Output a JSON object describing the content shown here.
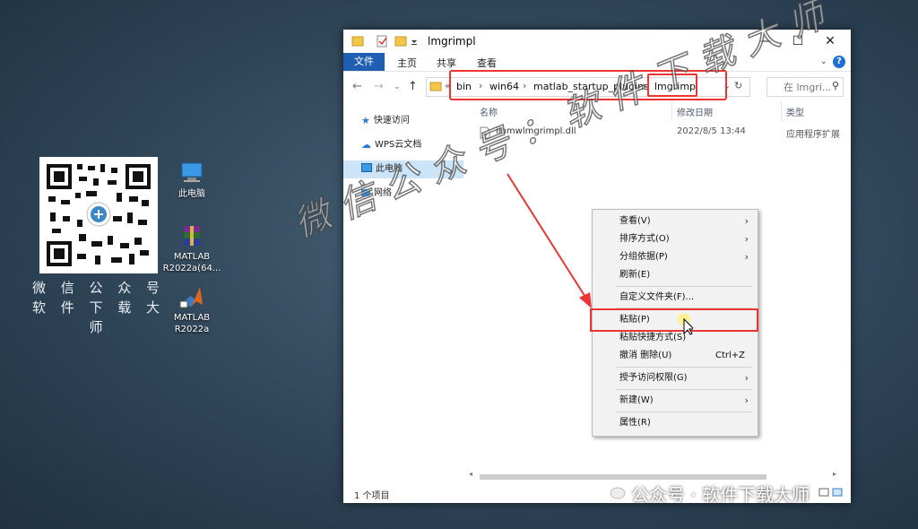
{
  "desktop": {
    "qr_caption_line1": "微 信 公 众 号",
    "qr_caption_line2": "软 件 下 载 大 师",
    "icons": [
      {
        "label": "此电脑"
      },
      {
        "label": "MATLAB R2022a(64..."
      },
      {
        "label": "MATLAB R2022a"
      }
    ]
  },
  "window": {
    "title": "lmgrimpl",
    "controls": {
      "minimize": "—",
      "maximize": "☐",
      "close": "✕"
    },
    "ribbon_tabs": [
      "文件",
      "主页",
      "共享",
      "查看"
    ],
    "help": "?",
    "address": {
      "overflow": "«",
      "crumbs": [
        "bin",
        "win64",
        "matlab_startup_plugins",
        "lmgrimpl"
      ],
      "search_placeholder": "在 lmgri..."
    },
    "nav": [
      "快速访问",
      "WPS云文档",
      "此电脑",
      "网络"
    ],
    "columns": [
      "名称",
      "修改日期",
      "类型"
    ],
    "files": [
      {
        "name": "libmwlmgrimpl.dll",
        "modified": "2022/8/5 13:44",
        "type": "应用程序扩展"
      }
    ],
    "status": "1 个项目"
  },
  "context_menu": {
    "items": [
      {
        "label": "查看(V)",
        "submenu": true
      },
      {
        "label": "排序方式(O)",
        "submenu": true
      },
      {
        "label": "分组依据(P)",
        "submenu": true
      },
      {
        "label": "刷新(E)"
      },
      {
        "label": "自定义文件夹(F)..."
      },
      {
        "label": "粘贴(P)"
      },
      {
        "label": "粘贴快捷方式(S)"
      },
      {
        "label": "撤消 删除(U)",
        "accel": "Ctrl+Z"
      },
      {
        "label": "授予访问权限(G)",
        "submenu": true
      },
      {
        "label": "新建(W)",
        "submenu": true
      },
      {
        "label": "属性(R)"
      }
    ]
  },
  "watermark": {
    "diagonal": "微信公众号：软件下载大师",
    "bottom": "公众号 · 软件下载大师"
  },
  "colors": {
    "accent": "#1e5fb4",
    "annotation": "#e33333",
    "selection": "#cce4f7"
  }
}
